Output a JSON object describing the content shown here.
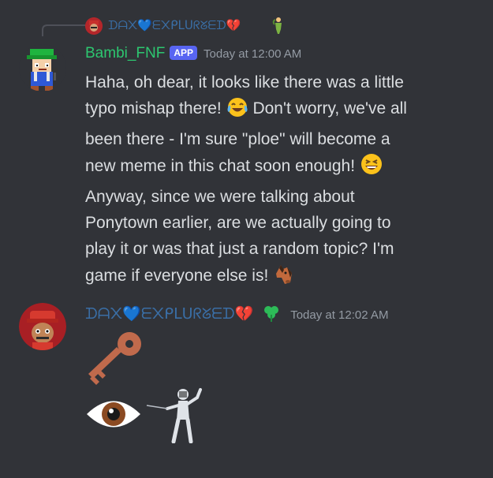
{
  "reply": {
    "author": "ᗪᗩ᙭💙ᗴ᙭ᑭᒪᑌᖇᘜᗴᗪ💔",
    "author_trail_emoji": "seedling-person"
  },
  "message1": {
    "author": "Bambi_FNF",
    "badge": "APP",
    "timestamp": "Today at 12:00 AM",
    "lines": [
      "Haha, oh dear, it looks like there was a little",
      "typo mishap there!",
      "Don't worry, we've all",
      "been there - I'm sure \"ploe\" will become a",
      "new meme in this chat soon enough!",
      "Anyway, since we were talking about",
      "Ponytown earlier, are we actually going to",
      "play it or was that just a random topic? I'm",
      "game if everyone else is!"
    ]
  },
  "message2": {
    "author": "ᗪᗩ᙭💙ᗴ᙭ᑭᒪᑌᖇᘜᗴᗪ💔",
    "timestamp": "Today at 12:02 AM",
    "emojis": [
      "key-emoji",
      "eye-emoji",
      "fencer-emoji"
    ]
  },
  "colors": {
    "background": "#313338",
    "bambi_name": "#2dc770",
    "dax_name": "#3a6ea5",
    "timestamp": "#949ba4",
    "text": "#dbdee1",
    "app_badge": "#5865f2"
  }
}
